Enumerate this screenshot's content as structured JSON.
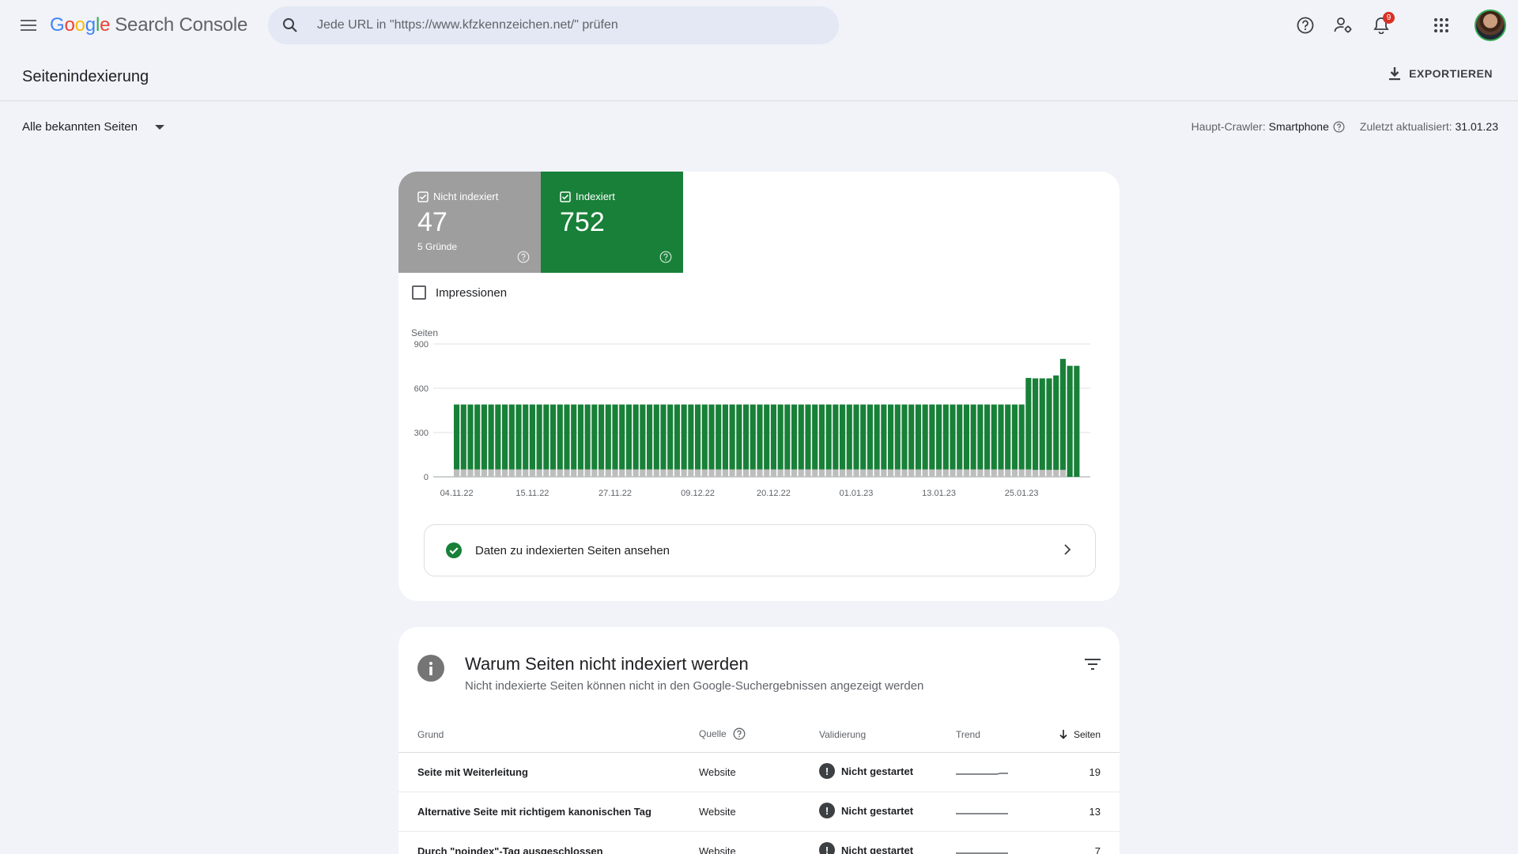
{
  "app": {
    "logo_google": [
      "G",
      "o",
      "o",
      "g",
      "l",
      "e"
    ],
    "logo_product": "Search Console",
    "search_placeholder": "Jede URL in \"https://www.kfzkennzeichen.net/\" prüfen",
    "notification_count": "9"
  },
  "header": {
    "title": "Seitenindexierung",
    "export_label": "EXPORTIEREN"
  },
  "filter": {
    "pages_selector": "Alle bekannten Seiten",
    "crawler_label": "Haupt-Crawler:",
    "crawler_value": "Smartphone",
    "updated_label": "Zuletzt aktualisiert:",
    "updated_value": "31.01.23"
  },
  "summary": {
    "not_indexed": {
      "label": "Nicht indexiert",
      "value": "47",
      "sub": "5 Gründe"
    },
    "indexed": {
      "label": "Indexiert",
      "value": "752"
    },
    "impressions_label": "Impressionen"
  },
  "colors": {
    "indexed": "#188038",
    "not_indexed": "#bdbdbd",
    "grid": "#e0e0e0"
  },
  "chart_data": {
    "type": "bar",
    "ylabel": "Seiten",
    "y_ticks": [
      0,
      300,
      600,
      900
    ],
    "ylim": [
      0,
      900
    ],
    "x_tick_labels": [
      "04.11.22",
      "15.11.22",
      "27.11.22",
      "09.12.22",
      "20.12.22",
      "01.01.23",
      "13.01.23",
      "25.01.23"
    ],
    "x_tick_indices": [
      0,
      11,
      23,
      35,
      46,
      58,
      70,
      82
    ],
    "grid": true,
    "series": [
      {
        "name": "Nicht indexiert",
        "stacked_position": "bottom",
        "values": [
          50,
          50,
          50,
          50,
          50,
          50,
          50,
          50,
          50,
          50,
          50,
          50,
          50,
          50,
          50,
          50,
          50,
          50,
          50,
          50,
          50,
          50,
          50,
          50,
          50,
          50,
          50,
          50,
          50,
          50,
          50,
          50,
          50,
          50,
          50,
          50,
          50,
          50,
          50,
          50,
          50,
          50,
          50,
          50,
          50,
          50,
          50,
          50,
          50,
          50,
          50,
          50,
          50,
          50,
          50,
          50,
          50,
          50,
          50,
          50,
          50,
          50,
          50,
          50,
          50,
          50,
          50,
          50,
          50,
          50,
          50,
          50,
          50,
          50,
          50,
          50,
          50,
          50,
          50,
          50,
          50,
          50,
          50,
          50,
          47,
          47,
          47,
          47,
          47
        ]
      },
      {
        "name": "Indexiert",
        "stacked_position": "top",
        "values": [
          440,
          440,
          440,
          440,
          440,
          440,
          440,
          440,
          440,
          440,
          440,
          440,
          440,
          440,
          440,
          440,
          440,
          440,
          440,
          440,
          440,
          440,
          440,
          440,
          440,
          440,
          440,
          440,
          440,
          440,
          440,
          440,
          440,
          440,
          440,
          440,
          440,
          440,
          440,
          440,
          440,
          440,
          440,
          440,
          440,
          440,
          440,
          440,
          440,
          440,
          440,
          440,
          440,
          440,
          440,
          440,
          440,
          440,
          440,
          440,
          440,
          440,
          440,
          440,
          440,
          440,
          440,
          440,
          440,
          440,
          440,
          440,
          440,
          440,
          440,
          440,
          440,
          440,
          440,
          440,
          440,
          440,
          440,
          620,
          620,
          620,
          620,
          640,
          752,
          752,
          752
        ]
      }
    ]
  },
  "view_indexed_label": "Daten zu indexierten Seiten ansehen",
  "reasons": {
    "title": "Warum Seiten nicht indexiert werden",
    "subtitle": "Nicht indexierte Seiten können nicht in den Google-Suchergebnissen angezeigt werden",
    "columns": {
      "reason": "Grund",
      "source": "Quelle",
      "validation": "Validierung",
      "trend": "Trend",
      "pages": "Seiten"
    },
    "rows": [
      {
        "reason": "Seite mit Weiterleitung",
        "source": "Website",
        "validation": "Nicht gestartet",
        "pages": "19"
      },
      {
        "reason": "Alternative Seite mit richtigem kanonischen Tag",
        "source": "Website",
        "validation": "Nicht gestartet",
        "pages": "13"
      },
      {
        "reason": "Durch \"noindex\"-Tag ausgeschlossen",
        "source": "Website",
        "validation": "Nicht gestartet",
        "pages": "7"
      }
    ]
  }
}
